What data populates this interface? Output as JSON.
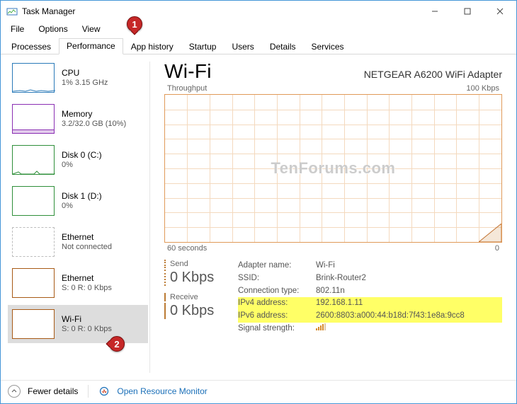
{
  "window": {
    "title": "Task Manager"
  },
  "menu": {
    "file": "File",
    "options": "Options",
    "view": "View"
  },
  "tabs": {
    "processes": "Processes",
    "performance": "Performance",
    "app_history": "App history",
    "startup": "Startup",
    "users": "Users",
    "details": "Details",
    "services": "Services"
  },
  "sidebar": {
    "items": [
      {
        "title": "CPU",
        "sub": "1% 3.15 GHz",
        "color": "#2a7ab9"
      },
      {
        "title": "Memory",
        "sub": "3.2/32.0 GB (10%)",
        "color": "#8a2fb3"
      },
      {
        "title": "Disk 0 (C:)",
        "sub": "0%",
        "color": "#2f8f3a"
      },
      {
        "title": "Disk 1 (D:)",
        "sub": "0%",
        "color": "#2f8f3a"
      },
      {
        "title": "Ethernet",
        "sub": "Not connected",
        "color": "#bdbdbd"
      },
      {
        "title": "Ethernet",
        "sub": "S: 0 R: 0 Kbps",
        "color": "#a85a16"
      },
      {
        "title": "Wi-Fi",
        "sub": "S: 0 R: 0 Kbps",
        "color": "#a85a16"
      }
    ]
  },
  "detail": {
    "title": "Wi-Fi",
    "adapter": "NETGEAR A6200 WiFi Adapter",
    "throughput_label": "Throughput",
    "ymax": "100 Kbps",
    "xleft": "60 seconds",
    "xright": "0",
    "send_label": "Send",
    "send_value": "0 Kbps",
    "recv_label": "Receive",
    "recv_value": "0 Kbps",
    "info": {
      "adapter_name_key": "Adapter name:",
      "adapter_name_val": "Wi-Fi",
      "ssid_key": "SSID:",
      "ssid_val": "Brink-Router2",
      "conn_type_key": "Connection type:",
      "conn_type_val": "802.11n",
      "ipv4_key": "IPv4 address:",
      "ipv4_val": "192.168.1.11",
      "ipv6_key": "IPv6 address:",
      "ipv6_val": "2600:8803:a000:44:b18d:7f43:1e8a:9cc8",
      "signal_key": "Signal strength:"
    }
  },
  "bottom": {
    "fewer": "Fewer details",
    "resmon": "Open Resource Monitor"
  },
  "annotations": {
    "one": "1",
    "two": "2"
  },
  "watermark": "TenForums.com",
  "chart_data": {
    "type": "line",
    "title": "Throughput",
    "xlabel": "seconds",
    "ylabel": "Kbps",
    "xlim": [
      0,
      60
    ],
    "ylim": [
      0,
      100
    ],
    "series": [
      {
        "name": "Send",
        "values_estimate": "near-zero across window"
      },
      {
        "name": "Receive",
        "values_estimate": "near-zero with brief spike to ~25 Kbps at right edge"
      }
    ]
  }
}
